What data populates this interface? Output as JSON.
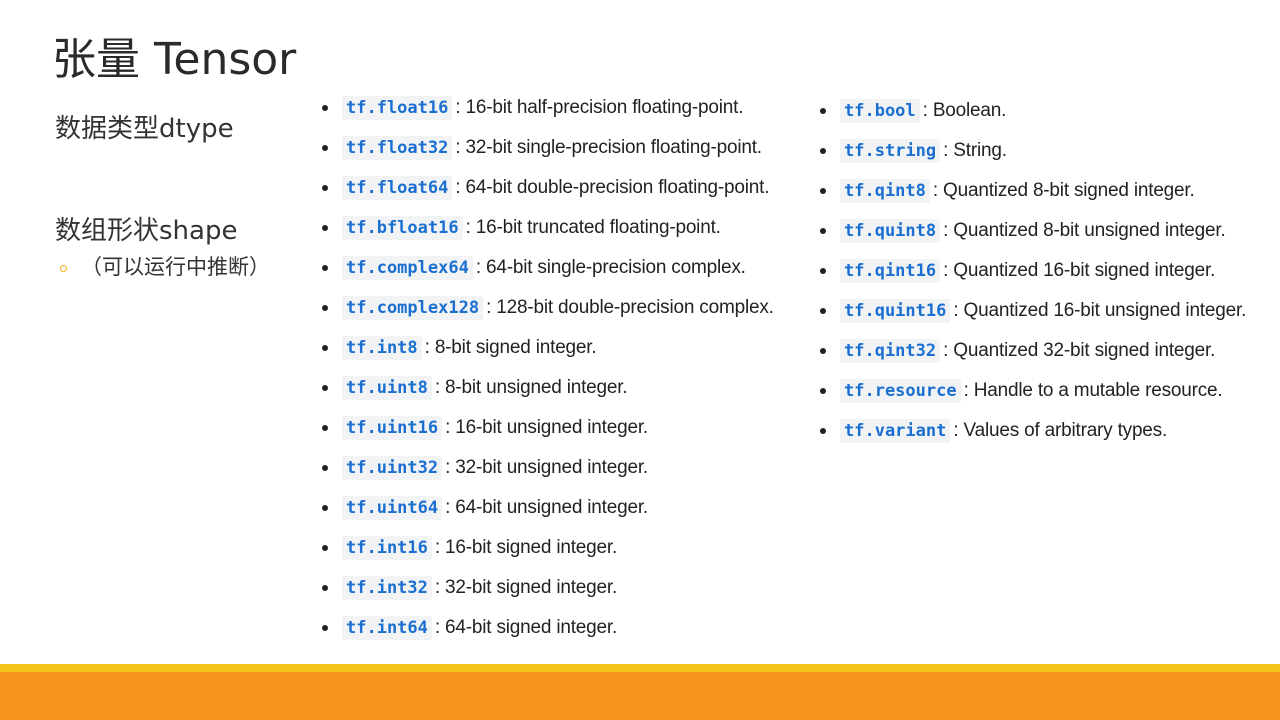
{
  "slide": {
    "title": "张量 Tensor",
    "left": {
      "heading1": "数据类型dtype",
      "heading2": "数组形状shape",
      "sub_bullet": "（可以运行中推断）"
    },
    "dtypes_col1": [
      {
        "code": "tf.float16",
        "desc": ": 16-bit half-precision floating-point."
      },
      {
        "code": "tf.float32",
        "desc": ": 32-bit single-precision floating-point."
      },
      {
        "code": "tf.float64",
        "desc": ": 64-bit double-precision floating-point."
      },
      {
        "code": "tf.bfloat16",
        "desc": ": 16-bit truncated floating-point."
      },
      {
        "code": "tf.complex64",
        "desc": ": 64-bit single-precision complex."
      },
      {
        "code": "tf.complex128",
        "desc": ": 128-bit double-precision complex."
      },
      {
        "code": "tf.int8",
        "desc": ": 8-bit signed integer."
      },
      {
        "code": "tf.uint8",
        "desc": ": 8-bit unsigned integer."
      },
      {
        "code": "tf.uint16",
        "desc": ": 16-bit unsigned integer."
      },
      {
        "code": "tf.uint32",
        "desc": ": 32-bit unsigned integer."
      },
      {
        "code": "tf.uint64",
        "desc": ": 64-bit unsigned integer."
      },
      {
        "code": "tf.int16",
        "desc": ": 16-bit signed integer."
      },
      {
        "code": "tf.int32",
        "desc": ": 32-bit signed integer."
      },
      {
        "code": "tf.int64",
        "desc": ": 64-bit signed integer."
      }
    ],
    "dtypes_col2": [
      {
        "code": "tf.bool",
        "desc": ": Boolean."
      },
      {
        "code": "tf.string",
        "desc": ": String."
      },
      {
        "code": "tf.qint8",
        "desc": ": Quantized 8-bit signed integer."
      },
      {
        "code": "tf.quint8",
        "desc": ": Quantized 8-bit unsigned integer."
      },
      {
        "code": "tf.qint16",
        "desc": ": Quantized 16-bit signed integer."
      },
      {
        "code": "tf.quint16",
        "desc": ": Quantized 16-bit unsigned integer."
      },
      {
        "code": "tf.qint32",
        "desc": ": Quantized 32-bit signed integer."
      },
      {
        "code": "tf.resource",
        "desc": ": Handle to a mutable resource."
      },
      {
        "code": "tf.variant",
        "desc": ": Values of arbitrary types."
      }
    ],
    "colors": {
      "code_text": "#1a6fd0",
      "code_bg": "#f1f3f4",
      "footer_stripe": "#f6c21c",
      "footer_bar": "#f7941d",
      "sub_bullet_ring": "#f5b21a"
    }
  }
}
